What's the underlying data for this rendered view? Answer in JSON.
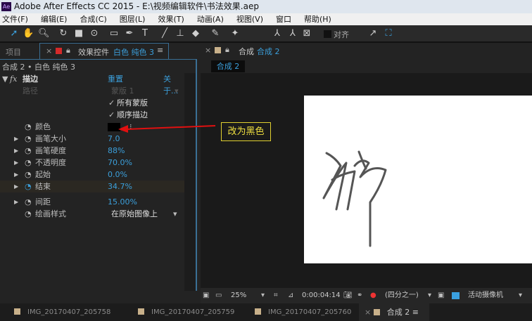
{
  "title": "Adobe After Effects CC 2015 - E:\\视频编辑软件\\书法效果.aep",
  "app_icon": "Ae",
  "menu": [
    "文件(F)",
    "编辑(E)",
    "合成(C)",
    "图层(L)",
    "效果(T)",
    "动画(A)",
    "视图(V)",
    "窗口",
    "帮助(H)"
  ],
  "toolbar": {
    "snap_label": "对齐"
  },
  "left_panel": {
    "project_tab": "项目",
    "effects_tab_prefix": "效果控件",
    "effects_tab_layer": "白色 纯色 3",
    "breadcrumb": "合成 2 • 白色 纯色 3",
    "effect": {
      "name": "描边",
      "reset": "重置",
      "about": "关于...",
      "path_label": "路径",
      "path_value": "蒙版 1",
      "all_masks": "所有蒙版",
      "sequential": "顺序描边",
      "color_label": "颜色",
      "props": [
        {
          "label": "画笔大小",
          "value": "7.0"
        },
        {
          "label": "画笔硬度",
          "value": "88%"
        },
        {
          "label": "不透明度",
          "value": "70.0%"
        },
        {
          "label": "起始",
          "value": "0.0%"
        },
        {
          "label": "结束",
          "value": "34.7%"
        },
        {
          "label": "间距",
          "value": "15.00%"
        }
      ],
      "paint_style_label": "绘画样式",
      "paint_style_value": "在原始图像上"
    }
  },
  "annotation": "改为黑色",
  "comp_panel": {
    "tab_prefix": "合成",
    "tab_name": "合成 2",
    "inner_tab": "合成 2"
  },
  "viewer_bar": {
    "zoom": "25%",
    "timecode": "0:00:04:14",
    "resolution": "(四分之一)",
    "camera": "活动摄像机"
  },
  "timeline_tabs": [
    "IMG_20170407_205758",
    "IMG_20170407_205759",
    "IMG_20170407_205760",
    "合成 2"
  ],
  "colors": {
    "accent": "#3b9fdb",
    "annotation": "#f0e040",
    "arrow": "#e01010"
  }
}
